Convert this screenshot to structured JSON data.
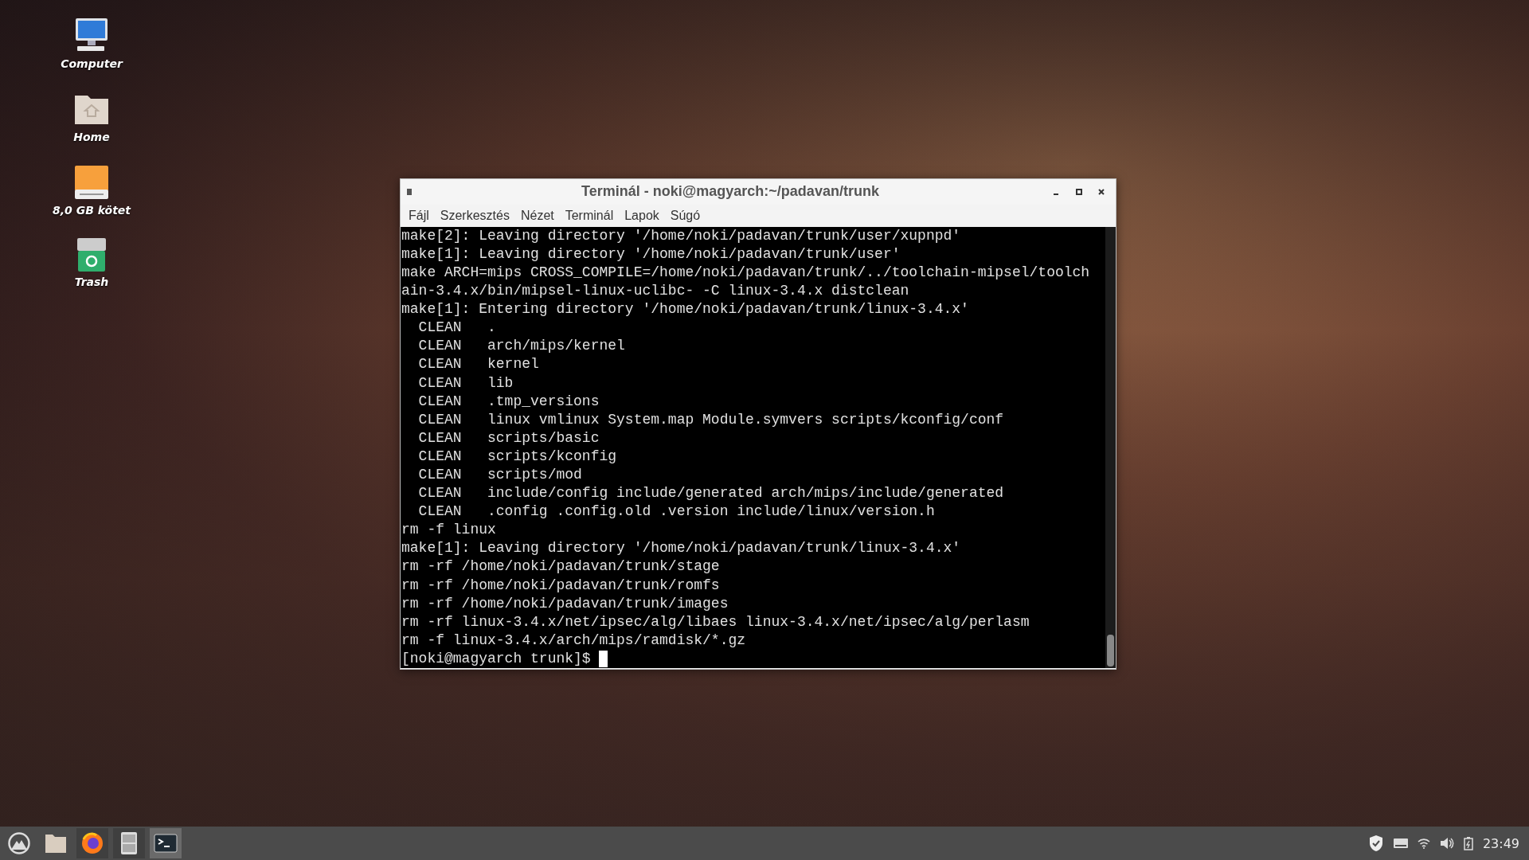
{
  "desktop_icons": [
    {
      "label": "Computer",
      "kind": "computer"
    },
    {
      "label": "Home",
      "kind": "home"
    },
    {
      "label": "8,0 GB kötet",
      "kind": "drive"
    },
    {
      "label": "Trash",
      "kind": "trash"
    }
  ],
  "window": {
    "title": "Terminál - noki@magyarch:~/padavan/trunk",
    "menu": [
      "Fájl",
      "Szerkesztés",
      "Nézet",
      "Terminál",
      "Lapok",
      "Súgó"
    ],
    "lines": [
      "make[2]: Leaving directory '/home/noki/padavan/trunk/user/xupnpd'",
      "make[1]: Leaving directory '/home/noki/padavan/trunk/user'",
      "make ARCH=mips CROSS_COMPILE=/home/noki/padavan/trunk/../toolchain-mipsel/toolch",
      "ain-3.4.x/bin/mipsel-linux-uclibc- -C linux-3.4.x distclean",
      "make[1]: Entering directory '/home/noki/padavan/trunk/linux-3.4.x'",
      "  CLEAN   .",
      "  CLEAN   arch/mips/kernel",
      "  CLEAN   kernel",
      "  CLEAN   lib",
      "  CLEAN   .tmp_versions",
      "  CLEAN   linux vmlinux System.map Module.symvers scripts/kconfig/conf",
      "  CLEAN   scripts/basic",
      "  CLEAN   scripts/kconfig",
      "  CLEAN   scripts/mod",
      "  CLEAN   include/config include/generated arch/mips/include/generated",
      "  CLEAN   .config .config.old .version include/linux/version.h",
      "rm -f linux",
      "make[1]: Leaving directory '/home/noki/padavan/trunk/linux-3.4.x'",
      "rm -rf /home/noki/padavan/trunk/stage",
      "rm -rf /home/noki/padavan/trunk/romfs",
      "rm -rf /home/noki/padavan/trunk/images",
      "rm -rf linux-3.4.x/net/ipsec/alg/libaes linux-3.4.x/net/ipsec/alg/perlasm",
      "rm -f linux-3.4.x/arch/mips/ramdisk/*.gz"
    ],
    "prompt": "[noki@magyarch trunk]$ "
  },
  "taskbar": {
    "apps": [
      {
        "kind": "launcher",
        "running": false,
        "selected": false
      },
      {
        "kind": "files",
        "running": false,
        "selected": false
      },
      {
        "kind": "browser",
        "running": true,
        "selected": false
      },
      {
        "kind": "cabinet",
        "running": true,
        "selected": false
      },
      {
        "kind": "terminal",
        "running": true,
        "selected": true
      }
    ],
    "clock": "23:49"
  }
}
